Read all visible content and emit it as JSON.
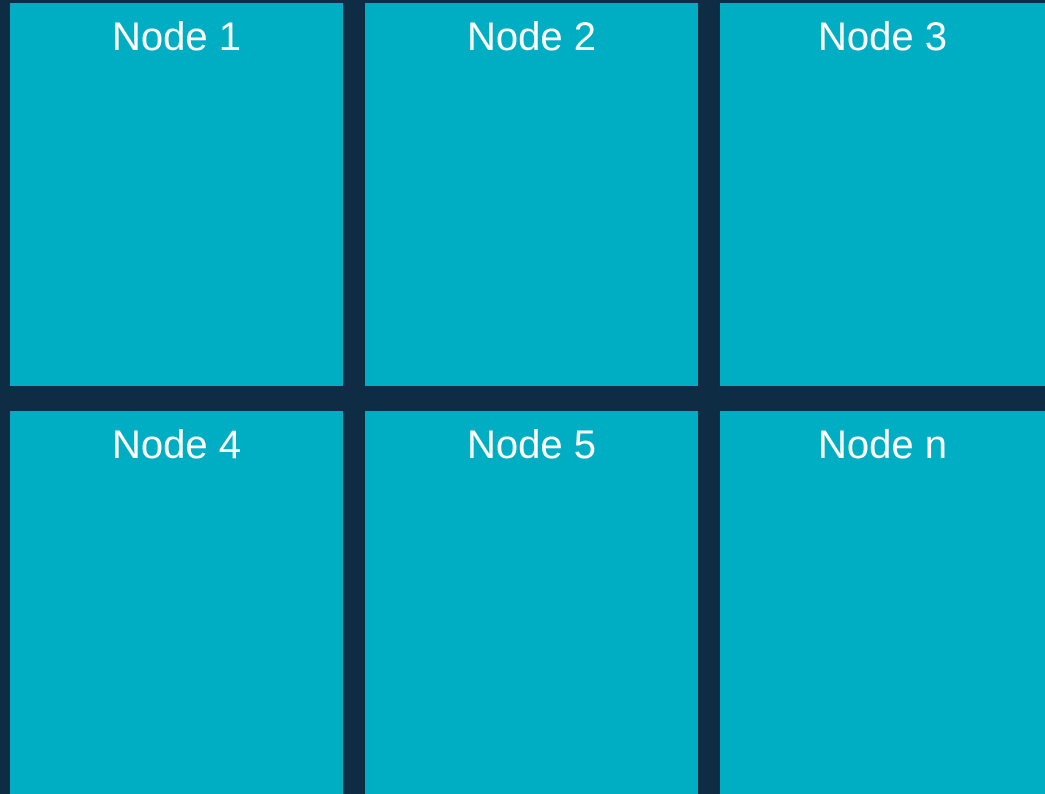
{
  "colors": {
    "background": "#0e2d44",
    "node_fill": "#00aec3",
    "label_text": "#ffffff"
  },
  "nodes": [
    {
      "label": "Node 1"
    },
    {
      "label": "Node 2"
    },
    {
      "label": "Node 3"
    },
    {
      "label": "Node 4"
    },
    {
      "label": "Node 5"
    },
    {
      "label": "Node n"
    }
  ]
}
